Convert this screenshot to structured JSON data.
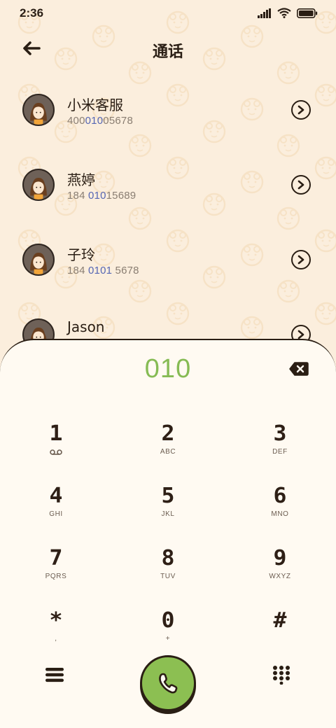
{
  "status_bar": {
    "time": "2:36",
    "icons": [
      "signal-icon",
      "wifi-icon",
      "battery-icon"
    ]
  },
  "header": {
    "title": "通话",
    "back_icon": "back-arrow-icon"
  },
  "contacts": [
    {
      "name": "小米客服",
      "number_pre": "400",
      "number_hl": "010",
      "number_post": "05678"
    },
    {
      "name": "燕婷",
      "number_pre": "184 ",
      "number_hl": "010",
      "number_post": "15689"
    },
    {
      "name": "子玲",
      "number_pre": "184 ",
      "number_hl": "0101",
      "number_post": " 5678"
    },
    {
      "name": "Jason",
      "number_pre": "",
      "number_hl": "",
      "number_post": ""
    }
  ],
  "dialer": {
    "input_value": "010",
    "backspace_icon": "backspace-icon",
    "keys": [
      {
        "digit": "1",
        "sub": "",
        "sub_icon": "voicemail-icon"
      },
      {
        "digit": "2",
        "sub": "ABC"
      },
      {
        "digit": "3",
        "sub": "DEF"
      },
      {
        "digit": "4",
        "sub": "GHI"
      },
      {
        "digit": "5",
        "sub": "JKL"
      },
      {
        "digit": "6",
        "sub": "MNO"
      },
      {
        "digit": "7",
        "sub": "PQRS"
      },
      {
        "digit": "8",
        "sub": "TUV"
      },
      {
        "digit": "9",
        "sub": "WXYZ"
      },
      {
        "digit": "*",
        "sub": ","
      },
      {
        "digit": "0",
        "sub": "+"
      },
      {
        "digit": "#",
        "sub": ""
      }
    ],
    "bottom": {
      "menu_icon": "menu-icon",
      "call_icon": "phone-icon",
      "keypad_icon": "dialpad-icon"
    }
  },
  "colors": {
    "background": "#fbeedd",
    "panel": "#fffaf2",
    "accent_green": "#8cbf52",
    "number_green": "#86bb54",
    "highlight_blue": "#5566b3",
    "ink": "#2a1e14"
  }
}
